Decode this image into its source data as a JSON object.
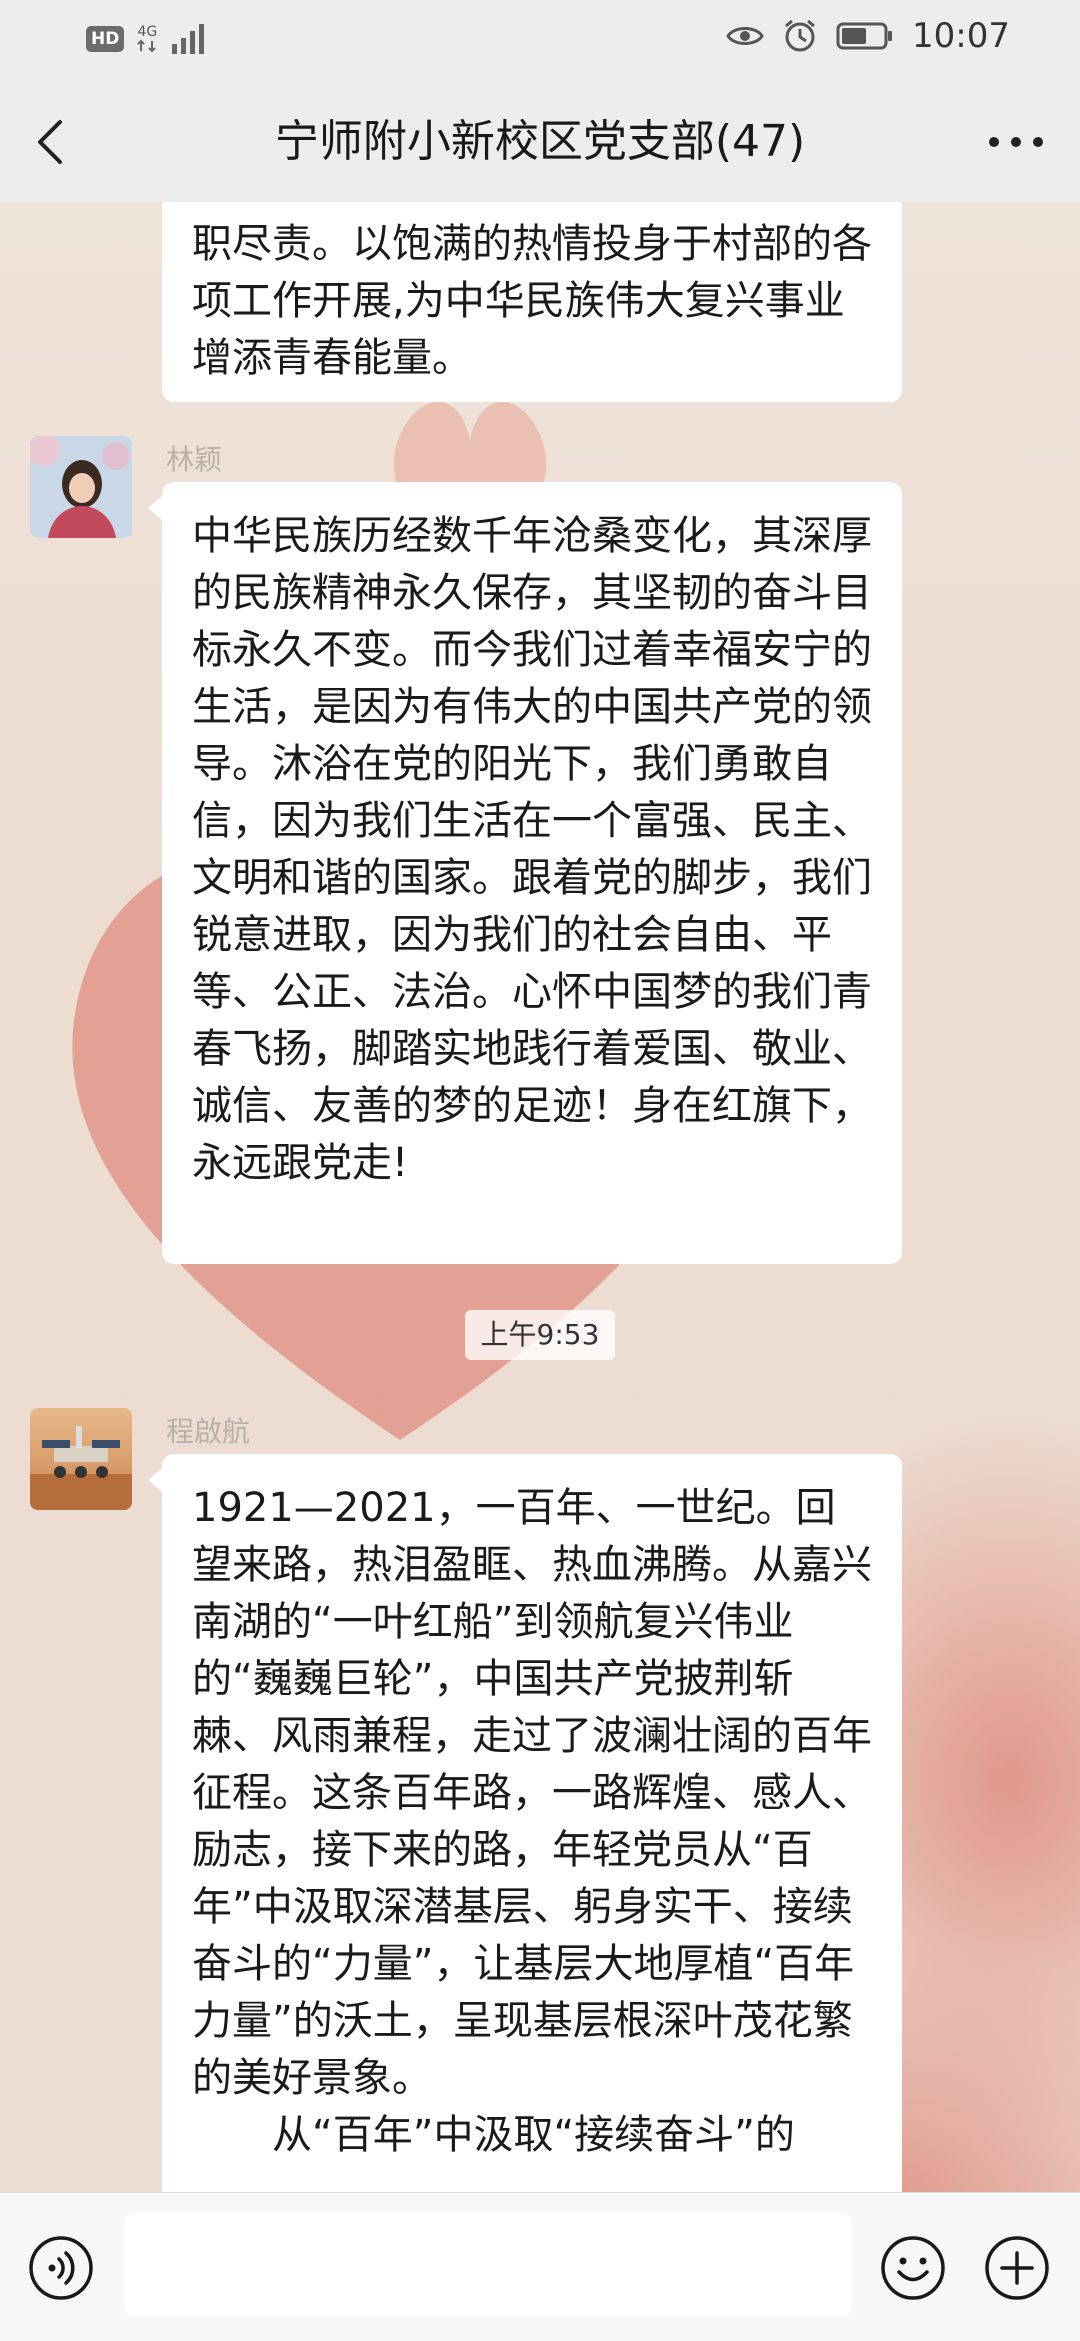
{
  "status_bar": {
    "hd_label": "HD",
    "network_label": "4G",
    "time": "10:07"
  },
  "header": {
    "title": "宁师附小新校区党支部(47)"
  },
  "messages": [
    {
      "type": "text",
      "paragraphs": [
        "职尽责。以饱满的热情投身于村部的各项工作开展,为中华民族伟大复兴事业增添青春能量。"
      ]
    },
    {
      "type": "text",
      "sender": "林颖",
      "paragraphs": [
        "中华民族历经数千年沧桑变化，其深厚的民族精神永久保存，其坚韧的奋斗目标永久不变。而今我们过着幸福安宁的生活，是因为有伟大的中国共产党的领导。沐浴在党的阳光下，我们勇敢自信，因为我们生活在一个富强、民主、文明和谐的国家。跟着党的脚步，我们锐意进取，因为我们的社会自由、平等、公正、法治。心怀中国梦的我们青春飞扬，脚踏实地践行着爱国、敬业、诚信、友善的梦的足迹！身在红旗下，永远跟党走!"
      ]
    },
    {
      "type": "time",
      "text": "上午9:53"
    },
    {
      "type": "text",
      "sender": "程啟航",
      "paragraphs": [
        "1921—2021，一百年、一世纪。回望来路，热泪盈眶、热血沸腾。从嘉兴南湖的“一叶红船”到领航复兴伟业的“巍巍巨轮”，中国共产党披荆斩棘、风雨兼程，走过了波澜壮阔的百年征程。这条百年路，一路辉煌、感人、励志，接下来的路，年轻党员从“百年”中汲取深潜基层、躬身实干、接续奋斗的“力量”，让基层大地厚植“百年力量”的沃土，呈现基层根深叶茂花繁的美好景象。",
        "从“百年”中汲取“接续奋斗”的"
      ]
    }
  ],
  "input": {
    "value": ""
  },
  "icons": {
    "back": "back-chevron-icon",
    "more": "more-dots-icon",
    "voice": "voice-icon",
    "emoji": "emoji-icon",
    "plus": "plus-icon",
    "eye": "eye-icon",
    "alarm": "alarm-icon",
    "battery": "battery-icon",
    "signal": "signal-icon"
  },
  "colors": {
    "bubble": "#ffffff",
    "header_bg": "#ededed",
    "wallpaper_heart": "#dd8d80"
  }
}
